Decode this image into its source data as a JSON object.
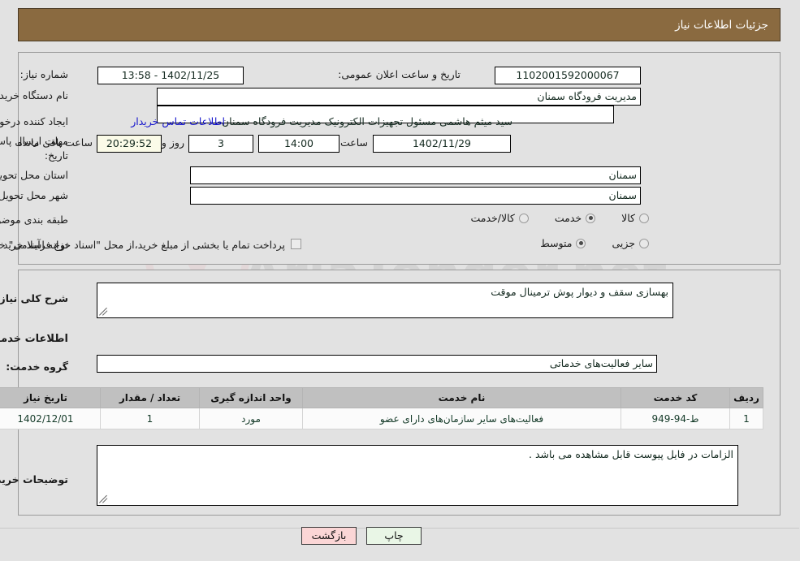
{
  "header": {
    "title": "جزئیات اطلاعات نیاز"
  },
  "form": {
    "need_number_label": "شماره نیاز:",
    "need_number_value": "1102001592000067",
    "public_announce_label": "تاریخ و ساعت اعلان عمومی:",
    "public_announce_value": "13:58 - 1402/11/25",
    "buyer_org_label": "نام دستگاه خریدار:",
    "buyer_org_value": "مدیریت فرودگاه سمنان",
    "buyer_org_extra_value": "",
    "creator_label": "ایجاد کننده درخواست:",
    "creator_value": "سید میثم هاشمی مسئول تجهیزات الکترونیک مدیریت فرودگاه سمنان",
    "creator_value_short": "سید میثم هاشمی مسئول تجهیزات الکترونیک مدیریت فرودگاه سمنان",
    "contact_link": "اطلاعات تماس خریدار",
    "deadline_label_line1": "مهلت ارسال پاسخ: تا",
    "deadline_label_line2": "تاریخ:",
    "deadline_date": "1402/11/29",
    "deadline_hour_label": "ساعت",
    "deadline_hour": "14:00",
    "remaining_days": "3",
    "remaining_days_label": "روز و",
    "remaining_time": "20:29:52",
    "remaining_time_label": "ساعت باقی مانده",
    "province_label": "استان محل تحویل:",
    "province_value": "سمنان",
    "city_label": "شهر محل تحویل:",
    "city_value": "سمنان",
    "category_label": "طبقه بندی موضوعی:",
    "category_options": [
      {
        "label": "کالا",
        "selected": false
      },
      {
        "label": "خدمت",
        "selected": true
      },
      {
        "label": "کالا/خدمت",
        "selected": false
      }
    ],
    "process_label": "نوع فرآیند خرید :",
    "process_options": [
      {
        "label": "جزیی",
        "selected": false
      },
      {
        "label": "متوسط",
        "selected": true
      }
    ],
    "treasury_checkbox_checked": false,
    "treasury_note": "پرداخت تمام یا بخشی از مبلغ خرید،از محل \"اسناد خزانه اسلامی\" خواهد بود."
  },
  "details": {
    "general_desc_label": "شرح کلی نیاز:",
    "general_desc_value": "بهسازی سقف و دیوار پوش ترمینال موقت",
    "services_section_title": "اطلاعات خدمات مورد نیاز",
    "service_group_label": "گروه خدمت:",
    "service_group_value": "سایر فعالیت‌های خدماتی",
    "buyer_notes_label": "توضیحات خریدار:",
    "buyer_notes_value": "الزامات در فایل پیوست قابل مشاهده می باشد ."
  },
  "table": {
    "columns": [
      "ردیف",
      "کد خدمت",
      "نام خدمت",
      "واحد اندازه گیری",
      "تعداد / مقدار",
      "تاریخ نیاز"
    ],
    "rows": [
      {
        "row": "1",
        "service_code": "ط-94-949",
        "service_name": "فعالیت‌های سایر سازمان‌های دارای عضو",
        "unit": "مورد",
        "quantity": "1",
        "need_date": "1402/12/01"
      }
    ]
  },
  "footer": {
    "print_label": "چاپ",
    "back_label": "بازگشت"
  },
  "colors": {
    "header_bg": "#8a6a40",
    "page_bg": "#e2e2e2",
    "link": "#1414cc",
    "print_btn": "#e9f6e6",
    "back_btn": "#fbd6d6",
    "timer_bg": "#fbfbe8",
    "table_header": "#c0c0c0"
  },
  "watermark": {
    "text": "AriaTender.net"
  }
}
